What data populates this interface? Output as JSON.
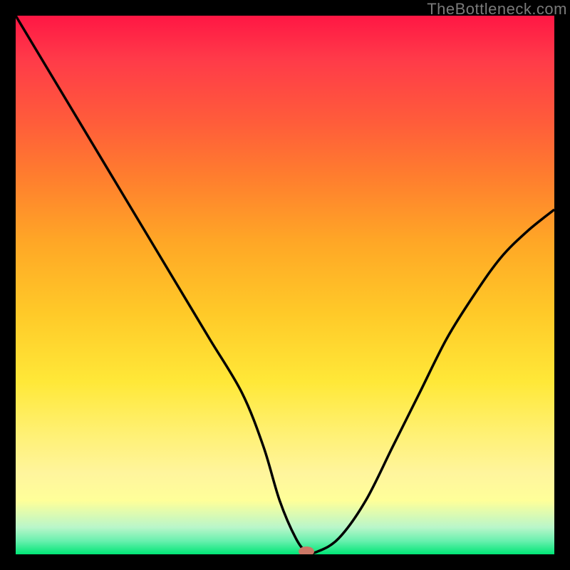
{
  "watermark": "TheBottleneck.com",
  "chart_data": {
    "type": "line",
    "title": "",
    "xlabel": "",
    "ylabel": "",
    "xlim": [
      0,
      100
    ],
    "ylim": [
      0,
      100
    ],
    "x": [
      0,
      6,
      12,
      18,
      24,
      30,
      36,
      42,
      46,
      49,
      52,
      54,
      56,
      60,
      65,
      70,
      75,
      80,
      85,
      90,
      95,
      100
    ],
    "values": [
      100,
      90,
      80,
      70,
      60,
      50,
      40,
      30,
      20,
      10,
      3,
      0.5,
      0.5,
      3,
      10,
      20,
      30,
      40,
      48,
      55,
      60,
      64
    ],
    "marker": {
      "x": 54,
      "y": 0.5
    },
    "gradient_stops": [
      {
        "pos": 0,
        "color": "#ff1744"
      },
      {
        "pos": 50,
        "color": "#ffc928"
      },
      {
        "pos": 90,
        "color": "#ffff99"
      },
      {
        "pos": 100,
        "color": "#00e676"
      }
    ]
  }
}
